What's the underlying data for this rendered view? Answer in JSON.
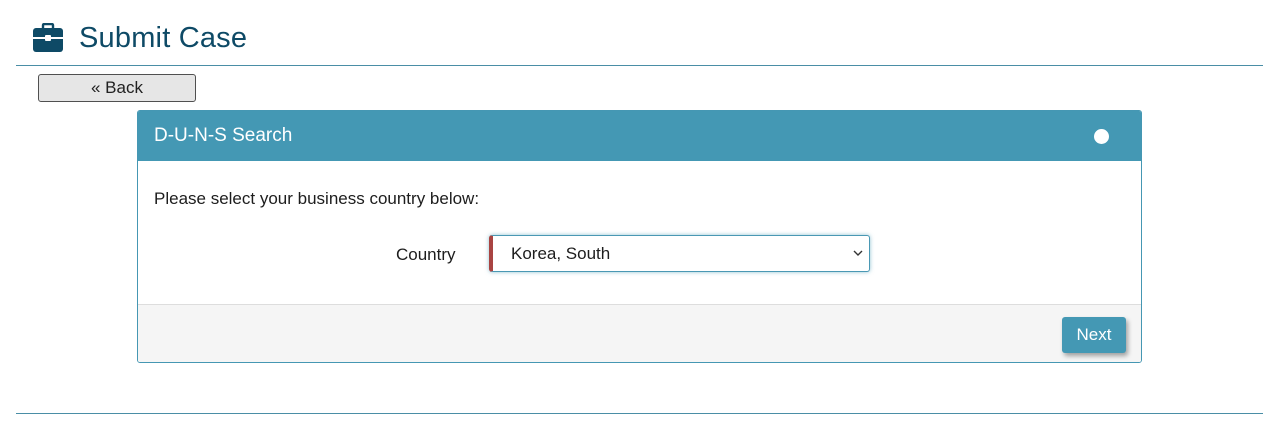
{
  "header": {
    "icon": "briefcase-icon",
    "title": "Submit Case",
    "title_color": "#0e4a66"
  },
  "back_button": {
    "label": "« Back"
  },
  "panel": {
    "title": "D-U-N-S Search",
    "accent_color": "#4498b4",
    "status_indicator_icon": "circle-icon",
    "instructions": "Please select your business country below:",
    "country": {
      "label": "Country",
      "selected_value": "Korea, South",
      "validation_color": "#a94442"
    },
    "next_label": "Next"
  }
}
